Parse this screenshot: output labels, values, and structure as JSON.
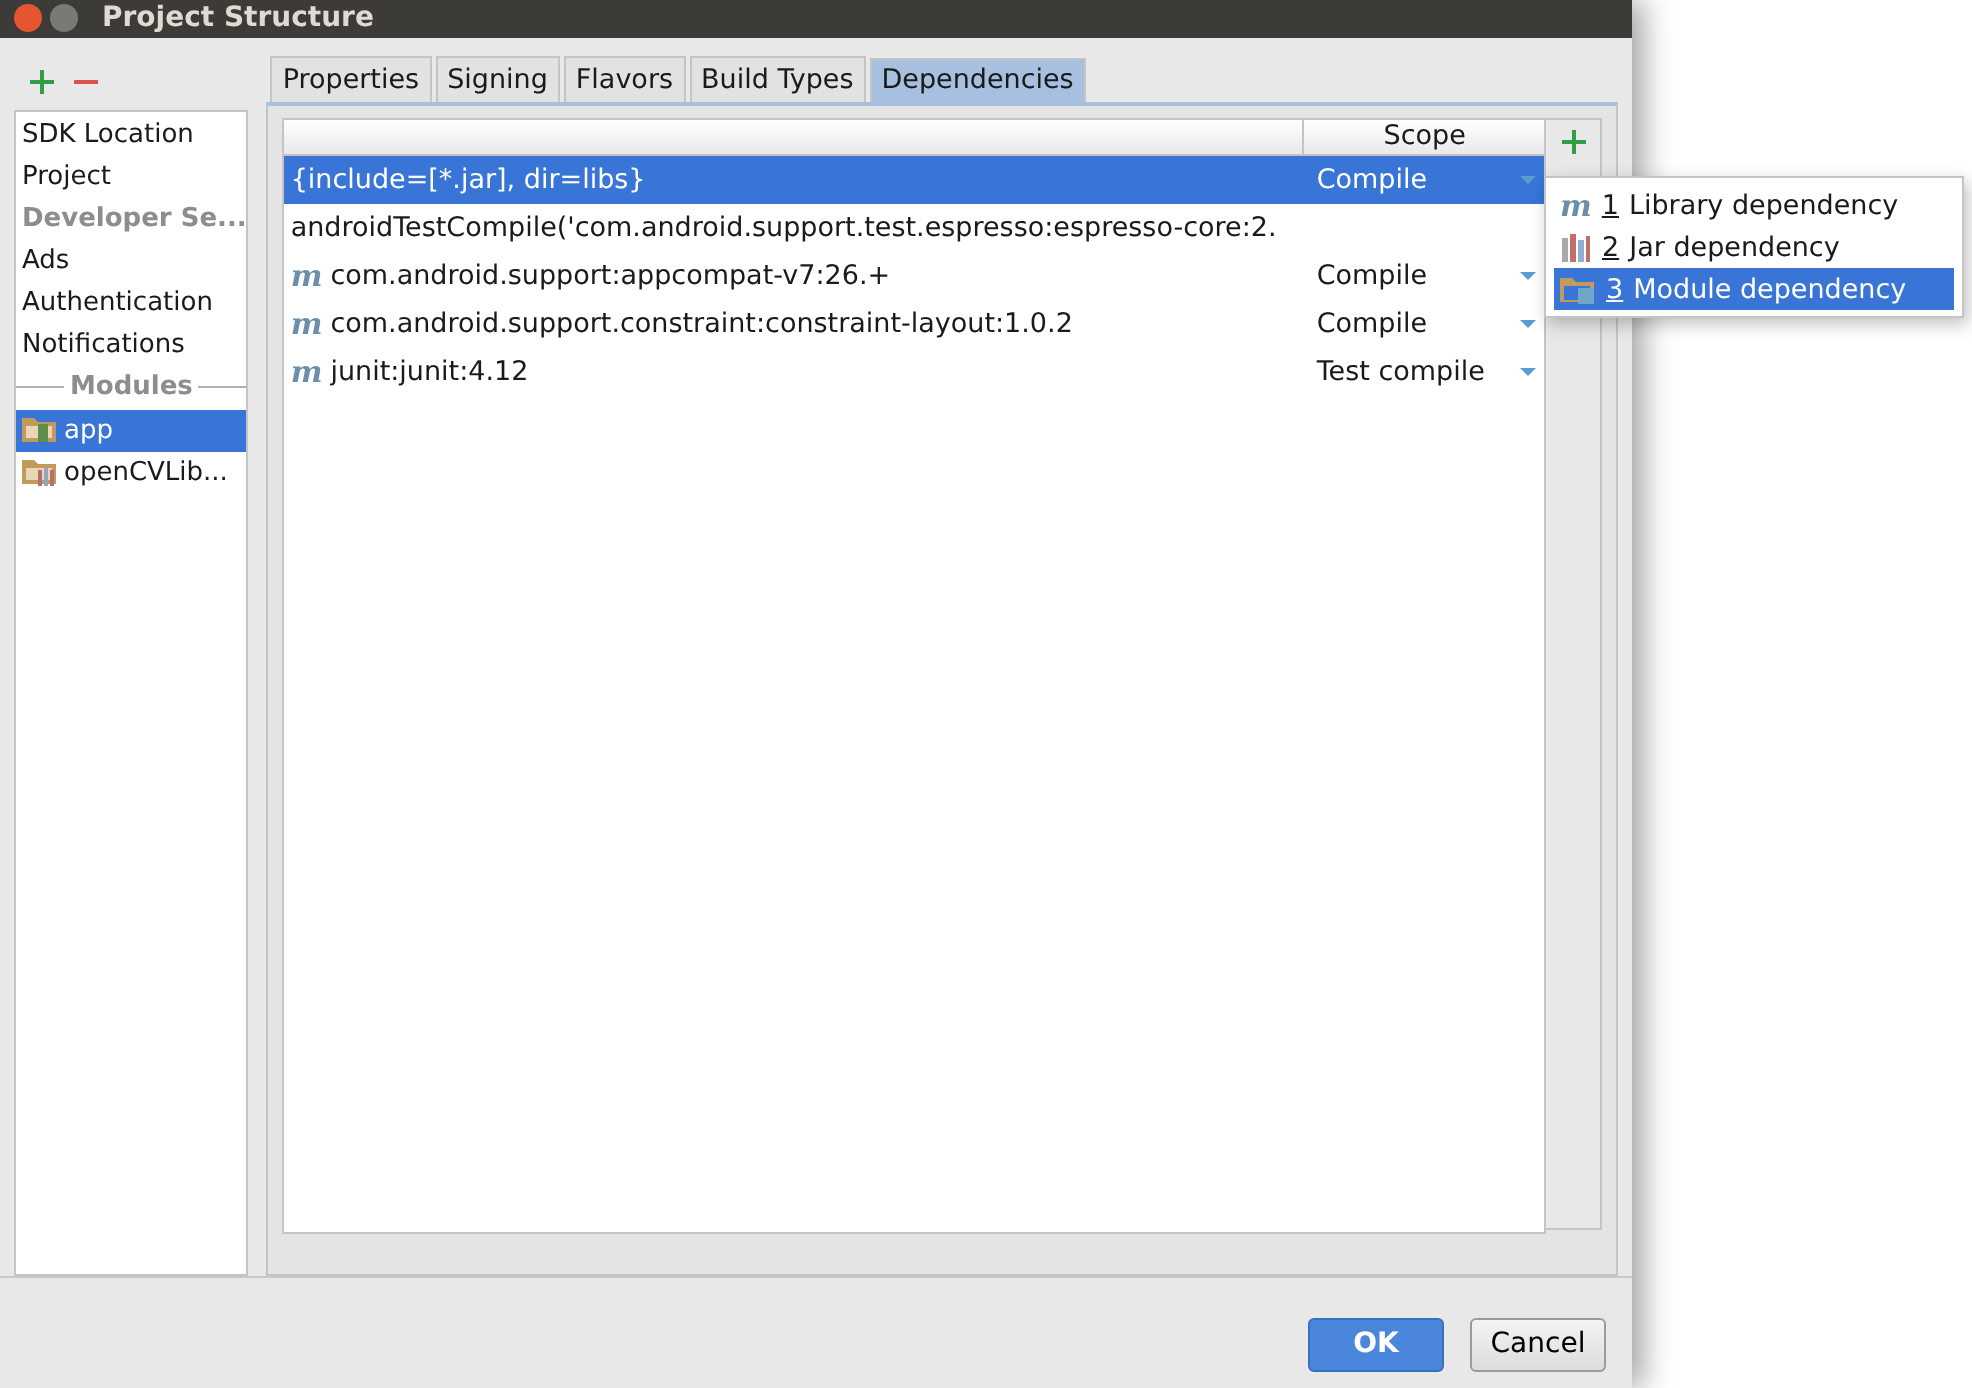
{
  "window": {
    "title": "Project Structure"
  },
  "sidebar": {
    "items": [
      {
        "kind": "item",
        "label": "SDK Location",
        "selected": false
      },
      {
        "kind": "item",
        "label": "Project",
        "selected": false
      },
      {
        "kind": "header",
        "label": "Developer Se..."
      },
      {
        "kind": "item",
        "label": "Ads",
        "selected": false
      },
      {
        "kind": "item",
        "label": "Authentication",
        "selected": false
      },
      {
        "kind": "item",
        "label": "Notifications",
        "selected": false
      },
      {
        "kind": "section",
        "label": "Modules"
      },
      {
        "kind": "app-module",
        "label": "app",
        "selected": true
      },
      {
        "kind": "library-module",
        "label": "openCVLib...",
        "selected": false
      }
    ]
  },
  "tabs": [
    {
      "label": "Properties",
      "selected": false
    },
    {
      "label": "Signing",
      "selected": false
    },
    {
      "label": "Flavors",
      "selected": false
    },
    {
      "label": "Build Types",
      "selected": false
    },
    {
      "label": "Dependencies",
      "selected": true
    }
  ],
  "table": {
    "scope_header": "Scope",
    "rows": [
      {
        "kind": "file",
        "name": "{include=[*.jar], dir=libs}",
        "scope": "Compile",
        "selected": true
      },
      {
        "kind": "text",
        "name": "androidTestCompile('com.android.support.test.espresso:espresso-core:2.",
        "selected": false
      },
      {
        "kind": "maven",
        "marker": "m",
        "name": "com.android.support:appcompat-v7:26.+",
        "scope": "Compile",
        "selected": false
      },
      {
        "kind": "maven",
        "marker": "m",
        "name": "com.android.support.constraint:constraint-layout:1.0.2",
        "scope": "Compile",
        "selected": false
      },
      {
        "kind": "maven",
        "marker": "m",
        "name": "junit:junit:4.12",
        "scope": "Test compile",
        "selected": false
      }
    ]
  },
  "menu": {
    "items": [
      {
        "kind": "maven",
        "marker": "m",
        "mnemonic": "1",
        "label": "Library dependency",
        "selected": false
      },
      {
        "kind": "jar",
        "mnemonic": "2",
        "label": "Jar dependency",
        "selected": false
      },
      {
        "kind": "module",
        "mnemonic": "3",
        "label": "Module dependency",
        "selected": true
      }
    ]
  },
  "buttons": [
    {
      "kind": "default",
      "label": "OK"
    },
    {
      "kind": "normal",
      "label": "Cancel"
    }
  ]
}
